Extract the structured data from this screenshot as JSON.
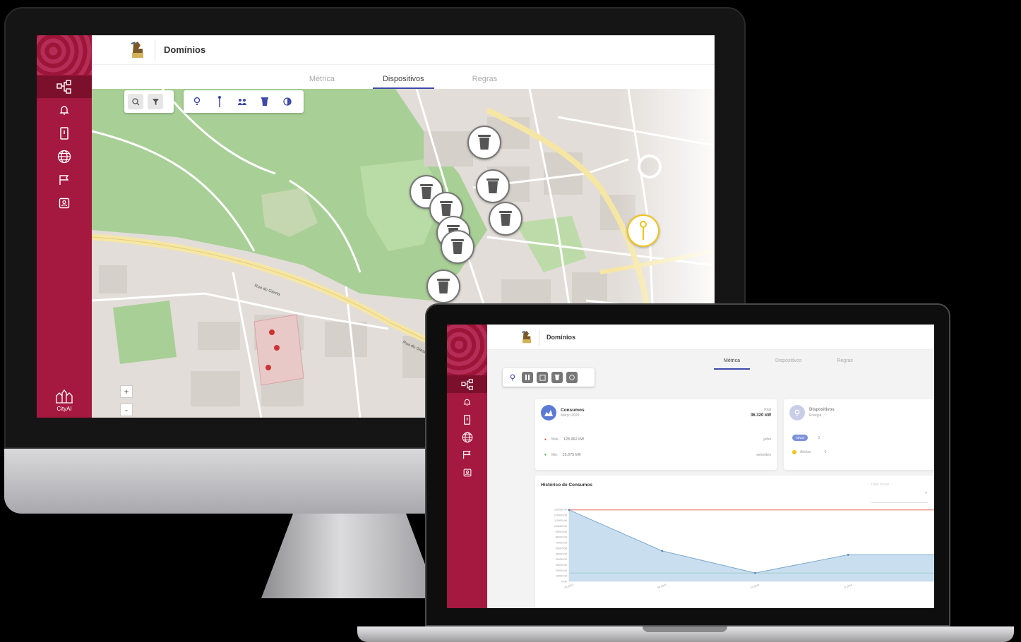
{
  "app": {
    "brand": "CityAI",
    "domain_title": "Domínios"
  },
  "tabs": [
    {
      "label": "Métrica"
    },
    {
      "label": "Dispositivos"
    },
    {
      "label": "Regras"
    }
  ],
  "desktop": {
    "active_tab": "Dispositivos"
  },
  "map": {
    "streets": [
      "Rua do Giesta",
      "Rua do Giesta"
    ],
    "zoom_in": "+",
    "zoom_out": "-"
  },
  "laptop": {
    "active_tab": "Métrica",
    "consumption_card": {
      "title": "Consumos",
      "subtitle": "Março 2020",
      "total_label": "Total",
      "total_value": "36.320 kW",
      "rows": [
        {
          "marker": "▲",
          "label": "Max.",
          "value": "128.962 kW",
          "time": "julho"
        },
        {
          "marker": "▼",
          "label": "Min.",
          "value": "15.075 kW",
          "time": "setembro"
        }
      ]
    },
    "devices_card": {
      "title": "Dispositivos",
      "subtitle": "Energia",
      "rows": [
        {
          "badge": "Ativos",
          "value": "3"
        },
        {
          "badge": "Alertas",
          "value": "0"
        }
      ]
    },
    "history_card": {
      "title": "Histórico de Consumos",
      "select_placeholder": "Data Inicial",
      "y_ticks": [
        "130000 kW",
        "120000 kW",
        "110000 kW",
        "100000 kW",
        "90000 kW",
        "80000 kW",
        "70000 kW",
        "60000 kW",
        "50000 kW",
        "40000 kW",
        "30000 kW",
        "20000 kW",
        "10000 kW",
        "0 kW"
      ],
      "x_ticks": [
        "08.2019",
        "09.2019",
        "10.2019",
        "11.2019",
        "12.2019"
      ]
    }
  },
  "chart_data": {
    "type": "area",
    "title": "Histórico de Consumos",
    "x": [
      "08.2019",
      "09.2019",
      "10.2019",
      "11.2019",
      "12.2019"
    ],
    "series": [
      {
        "values": [
          128962,
          55000,
          15075,
          48000,
          48000
        ]
      }
    ],
    "reference_lines": [
      128962,
      15075
    ],
    "ylim": [
      0,
      130000
    ]
  },
  "colors": {
    "sidebar": "#a5183f",
    "accent": "#3d4aa8",
    "park": "#a8cf96",
    "road": "#f6e6a3",
    "max_line": "#e8553a",
    "min_line": "#4caf50",
    "area": "#b7d4ea"
  }
}
